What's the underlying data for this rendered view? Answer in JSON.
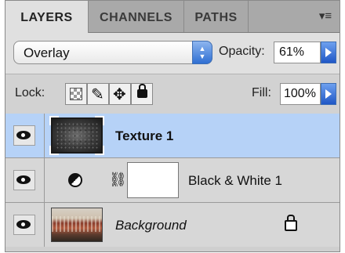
{
  "panel": {
    "tabs": [
      {
        "label": "LAYERS",
        "active": true
      },
      {
        "label": "CHANNELS",
        "active": false
      },
      {
        "label": "PATHS",
        "active": false
      }
    ],
    "menu_icon": "panel-menu-icon"
  },
  "blend": {
    "mode": "Overlay",
    "opacity_label": "Opacity:",
    "opacity_value": "61%"
  },
  "lock": {
    "label": "Lock:",
    "icons": [
      "lock-transparent-pixels-icon",
      "lock-image-pixels-icon",
      "lock-position-icon",
      "lock-all-icon"
    ],
    "fill_label": "Fill:",
    "fill_value": "100%"
  },
  "layers": [
    {
      "name": "Texture 1",
      "selected": true,
      "visible": true
    },
    {
      "name": "Black & White 1",
      "selected": false,
      "visible": true
    },
    {
      "name": "Background",
      "selected": false,
      "visible": true,
      "locked": true
    }
  ],
  "colors": {
    "selection": "#b6d2f7",
    "accent_blue": "#2f6fd3",
    "panel_bg": "#d7d7d7"
  }
}
